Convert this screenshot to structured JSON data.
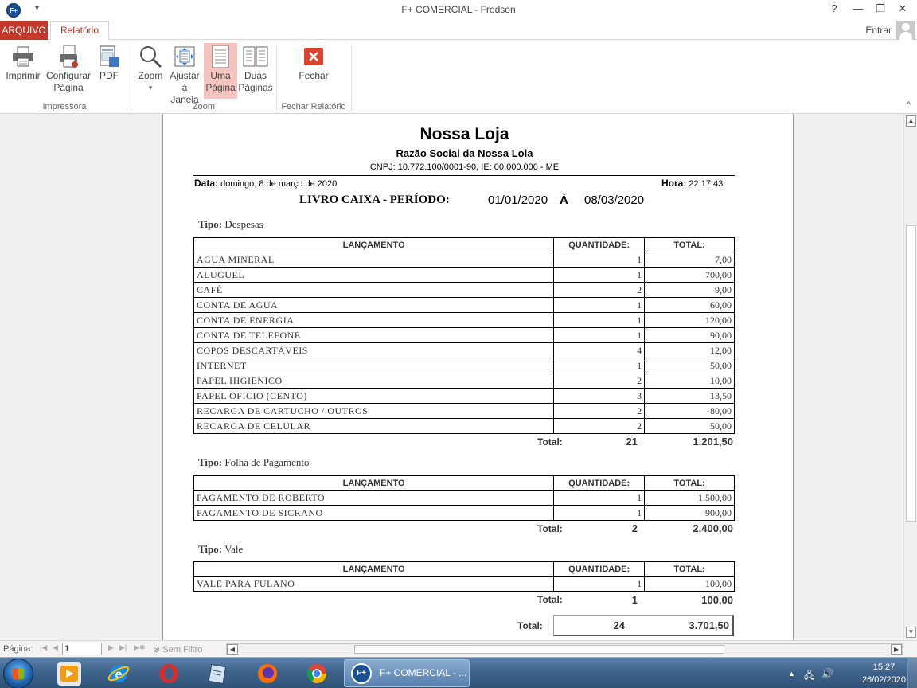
{
  "window": {
    "title": "F+ COMERCIAL - Fredson",
    "app_icon": "F+",
    "qa_arrow": "▾",
    "help": "?",
    "minimize": "—",
    "restore": "❐",
    "close": "✕"
  },
  "tabs": {
    "arquivo": "ARQUIVO",
    "relatorio": "Relatório",
    "signin": "Entrar"
  },
  "ribbon": {
    "impressora": {
      "imprimir": "Imprimir",
      "configurar": "Configurar",
      "configurar2": "Página",
      "pdf": "PDF",
      "label": "Impressora"
    },
    "zoom": {
      "zoom": "Zoom",
      "ajustar": "Ajustar",
      "ajustar2": "à Janela",
      "uma": "Uma",
      "uma2": "Página",
      "duas": "Duas",
      "duas2": "Páginas",
      "label": "Zoom"
    },
    "fechar": {
      "fechar": "Fechar",
      "label": "Fechar Relatório"
    },
    "collapse": "^"
  },
  "report": {
    "store_name": "Nossa Loja",
    "razao_social": "Razão Social da Nossa Loia",
    "cnpj_line": "CNPJ: 10.772.100/0001-90,  IE: 00.000.000 - ME",
    "data_label": "Data:",
    "data_value": "domingo, 8 de março de 2020",
    "hora_label": "Hora:",
    "hora_value": "22:17:43",
    "livro_title": "LIVRO CAIXA - PERÍODO:",
    "periodo_inicio": "01/01/2020",
    "periodo_sep": "À",
    "periodo_fim": "08/03/2020",
    "tipo_label": "Tipo:",
    "col_lancamento": "LANÇAMENTO",
    "col_quantidade": "QUANTIDADE:",
    "col_total": "TOTAL:",
    "total_label": "Total:",
    "groups": [
      {
        "tipo": "Despesas",
        "rows": [
          {
            "desc": "AGUA MINERAL",
            "qty": "1",
            "total": "7,00"
          },
          {
            "desc": "ALUGUEL",
            "qty": "1",
            "total": "700,00"
          },
          {
            "desc": "CAFÉ",
            "qty": "2",
            "total": "9,00"
          },
          {
            "desc": "CONTA DE AGUA",
            "qty": "1",
            "total": "60,00"
          },
          {
            "desc": "CONTA DE ENERGIA",
            "qty": "1",
            "total": "120,00"
          },
          {
            "desc": "CONTA DE TELEFONE",
            "qty": "1",
            "total": "90,00"
          },
          {
            "desc": "COPOS DESCARTÁVEIS",
            "qty": "4",
            "total": "12,00"
          },
          {
            "desc": "INTERNET",
            "qty": "1",
            "total": "50,00"
          },
          {
            "desc": "PAPEL HIGIENICO",
            "qty": "2",
            "total": "10,00"
          },
          {
            "desc": "PAPEL OFICIO (CENTO)",
            "qty": "3",
            "total": "13,50"
          },
          {
            "desc": "RECARGA DE CARTUCHO / OUTROS",
            "qty": "2",
            "total": "80,00"
          },
          {
            "desc": "RECARGA DE CELULAR",
            "qty": "2",
            "total": "50,00"
          }
        ],
        "total_qty": "21",
        "total_val": "1.201,50"
      },
      {
        "tipo": "Folha de Pagamento",
        "rows": [
          {
            "desc": "PAGAMENTO DE ROBERTO",
            "qty": "1",
            "total": "1.500,00"
          },
          {
            "desc": "PAGAMENTO DE SICRANO",
            "qty": "1",
            "total": "900,00"
          }
        ],
        "total_qty": "2",
        "total_val": "2.400,00"
      },
      {
        "tipo": "Vale",
        "rows": [
          {
            "desc": "VALE PARA FULANO",
            "qty": "1",
            "total": "100,00"
          }
        ],
        "total_qty": "1",
        "total_val": "100,00"
      }
    ],
    "grand_total_qty": "24",
    "grand_total_val": "3.701,50"
  },
  "navbar": {
    "pagina_label": "Página:",
    "page_value": "1",
    "first": "|◀",
    "prev": "◀",
    "next": "▶",
    "last": "▶|",
    "new": "▶✱",
    "filter": "Sem Filtro",
    "scroll_left": "◀",
    "scroll_right": "▶"
  },
  "taskbar": {
    "task_label": "F+ COMERCIAL - ...",
    "time": "15:27",
    "date": "26/02/2020"
  }
}
